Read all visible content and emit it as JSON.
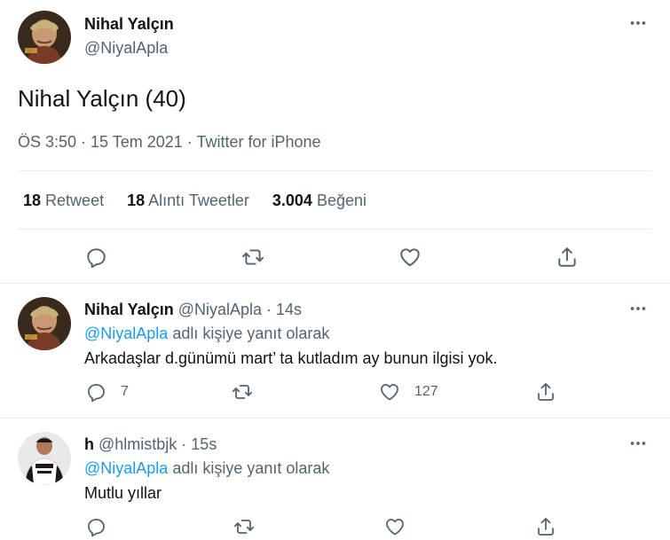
{
  "main": {
    "name": "Nihal Yalçın",
    "handle": "@NiyalApla",
    "text": "Nihal Yalçın (40)",
    "meta": "ÖS 3:50 · 15 Tem 2021 · Twitter for iPhone",
    "stats": {
      "retweets_count": "18",
      "retweets_label": "Retweet",
      "quotes_count": "18",
      "quotes_label": "Alıntı Tweetler",
      "likes_count": "3.004",
      "likes_label": "Beğeni"
    }
  },
  "replies": [
    {
      "name": "Nihal Yalçın",
      "handle": "@NiyalApla · 14s",
      "reply_mention": "@NiyalApla",
      "reply_suffix": " adlı kişiye yanıt olarak",
      "text": "Arkadaşlar d.günümü mart’ ta kutladım ay bunun ilgisi yok.",
      "reply_count": "7",
      "like_count": "127"
    },
    {
      "name": "h",
      "handle": "@hlmistbjk · 15s",
      "reply_mention": "@NiyalApla",
      "reply_suffix": " adlı kişiye yanıt olarak",
      "text": "Mutlu yıllar"
    }
  ],
  "icons": {
    "more": "more-horizontal-icon",
    "reply": "reply-icon",
    "retweet": "retweet-icon",
    "like": "heart-icon",
    "share": "share-icon"
  },
  "colors": {
    "text": "#0f1419",
    "secondary": "#536471",
    "accent": "#1d9bf0",
    "border": "#ebeef0"
  }
}
